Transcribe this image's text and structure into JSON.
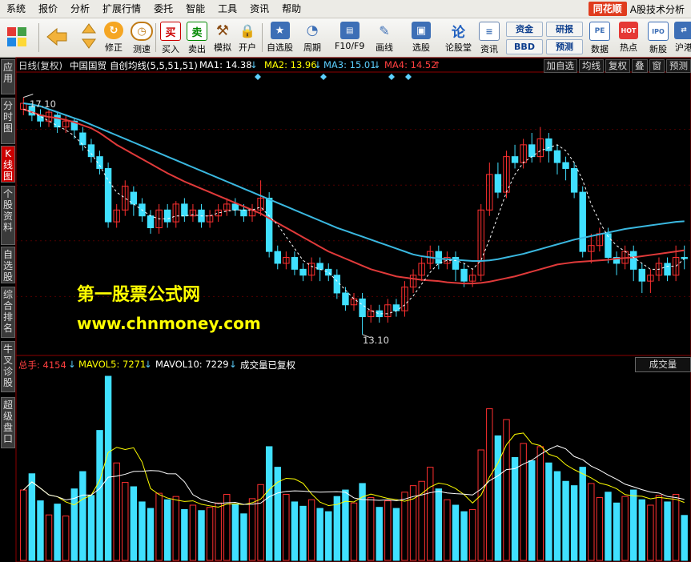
{
  "menubar": {
    "items": [
      "系统",
      "报价",
      "分析",
      "扩展行情",
      "委托",
      "智能",
      "工具",
      "资讯",
      "帮助"
    ],
    "brand_logo": "同花顺",
    "brand_text": "A股技术分析"
  },
  "toolbar": {
    "buttons": [
      "修正",
      "测速",
      "买入",
      "卖出",
      "模拟",
      "开户",
      "自选股",
      "周期",
      "F10/F9",
      "画线",
      "选股",
      "论股堂",
      "资讯",
      "数据",
      "热点",
      "新股",
      "沪港"
    ],
    "small_buttons": [
      "资金",
      "BBD",
      "研报",
      "预测"
    ]
  },
  "left_tabs": [
    "应用",
    "分时图",
    "K线图",
    "个股资料",
    "自选股",
    "综合排名",
    "牛叉诊股",
    "超级盘口"
  ],
  "chart_header": {
    "period": "日线(复权)",
    "stock_name": "中国国贸",
    "indicator": "自创均线(5,5,51,51)",
    "ma1_label": "MA1: 14.38",
    "ma2_label": "MA2: 13.96",
    "ma3_label": "MA3: 15.01",
    "ma4_label": "MA4: 14.52",
    "right_buttons": [
      "加自选",
      "均线",
      "复权",
      "叠",
      "窗",
      "预测"
    ]
  },
  "price_annotations": {
    "high": "17.10",
    "low": "13.10"
  },
  "volume_header": {
    "total": "总手: 4154",
    "mavol5": "MAVOL5: 7271",
    "mavol10": "MAVOL10: 7229",
    "note": "成交量已复权",
    "panel_button": "成交量"
  },
  "watermark": {
    "line1": "第一股票公式网",
    "line2": "www.chnmoney.com"
  },
  "colors": {
    "up": "#ff3030",
    "down": "#40e0ff",
    "ma_blue": "#3ab8e0",
    "ma_red": "#e03a3a",
    "ma_white": "#ffffff",
    "ma_yellow": "#ffff00"
  },
  "chart_data": {
    "type": "candlestick",
    "price_range": [
      12.8,
      17.5
    ],
    "candles": [
      [
        16.9,
        17.0,
        16.8,
        17.1
      ],
      [
        16.95,
        16.8,
        16.7,
        17.0
      ],
      [
        16.8,
        16.7,
        16.6,
        16.9
      ],
      [
        16.7,
        16.85,
        16.6,
        16.9
      ],
      [
        16.8,
        16.6,
        16.5,
        16.85
      ],
      [
        16.6,
        16.7,
        16.5,
        16.8
      ],
      [
        16.7,
        16.55,
        16.4,
        16.75
      ],
      [
        16.5,
        16.3,
        16.2,
        16.6
      ],
      [
        16.3,
        16.1,
        16.0,
        16.4
      ],
      [
        16.1,
        15.9,
        15.8,
        16.2
      ],
      [
        15.9,
        15.0,
        14.9,
        16.0
      ],
      [
        15.0,
        15.2,
        14.9,
        15.3
      ],
      [
        15.2,
        15.6,
        15.1,
        15.7
      ],
      [
        15.5,
        15.3,
        15.1,
        15.6
      ],
      [
        15.3,
        15.1,
        15.0,
        15.4
      ],
      [
        15.1,
        14.9,
        14.8,
        15.2
      ],
      [
        14.9,
        15.2,
        14.8,
        15.3
      ],
      [
        15.2,
        15.0,
        14.9,
        15.3
      ],
      [
        15.0,
        15.3,
        14.9,
        15.35
      ],
      [
        15.3,
        15.1,
        15.0,
        15.4
      ],
      [
        15.1,
        15.2,
        15.0,
        15.3
      ],
      [
        15.2,
        15.0,
        14.9,
        15.3
      ],
      [
        15.0,
        15.1,
        14.9,
        15.2
      ],
      [
        15.1,
        15.2,
        15.0,
        15.3
      ],
      [
        15.2,
        15.3,
        15.1,
        15.4
      ],
      [
        15.3,
        15.2,
        15.1,
        15.4
      ],
      [
        15.2,
        15.1,
        15.0,
        15.3
      ],
      [
        15.1,
        15.2,
        15.0,
        15.3
      ],
      [
        15.2,
        15.4,
        15.1,
        15.7
      ],
      [
        15.4,
        14.5,
        14.4,
        15.5
      ],
      [
        14.5,
        14.3,
        14.2,
        14.6
      ],
      [
        14.3,
        14.4,
        14.2,
        14.5
      ],
      [
        14.4,
        14.2,
        14.1,
        14.5
      ],
      [
        14.2,
        14.1,
        14.0,
        14.3
      ],
      [
        14.1,
        14.3,
        14.0,
        14.4
      ],
      [
        14.3,
        14.2,
        14.0,
        14.4
      ],
      [
        14.2,
        14.1,
        14.0,
        14.3
      ],
      [
        14.1,
        13.8,
        13.7,
        14.2
      ],
      [
        13.8,
        13.6,
        13.5,
        13.9
      ],
      [
        13.6,
        13.7,
        13.5,
        13.8
      ],
      [
        13.7,
        13.4,
        13.1,
        13.8
      ],
      [
        13.4,
        13.5,
        13.3,
        13.6
      ],
      [
        13.5,
        13.4,
        13.3,
        13.6
      ],
      [
        13.4,
        13.6,
        13.3,
        13.7
      ],
      [
        13.6,
        13.5,
        13.4,
        13.7
      ],
      [
        13.5,
        13.9,
        13.4,
        14.0
      ],
      [
        13.9,
        14.1,
        13.8,
        14.2
      ],
      [
        14.1,
        14.3,
        14.0,
        14.4
      ],
      [
        14.3,
        14.5,
        14.2,
        14.6
      ],
      [
        14.5,
        14.3,
        14.2,
        14.6
      ],
      [
        14.3,
        14.4,
        14.2,
        14.5
      ],
      [
        14.4,
        14.2,
        14.0,
        14.5
      ],
      [
        14.2,
        14.0,
        13.9,
        14.3
      ],
      [
        14.0,
        14.1,
        13.9,
        14.2
      ],
      [
        14.1,
        15.2,
        14.0,
        15.3
      ],
      [
        15.2,
        15.8,
        15.1,
        16.0
      ],
      [
        15.8,
        15.5,
        15.4,
        16.0
      ],
      [
        15.5,
        16.1,
        15.4,
        16.2
      ],
      [
        16.1,
        16.0,
        15.9,
        16.3
      ],
      [
        16.0,
        16.3,
        15.9,
        16.4
      ],
      [
        16.3,
        16.1,
        16.0,
        16.5
      ],
      [
        16.1,
        16.4,
        16.0,
        16.6
      ],
      [
        16.4,
        16.2,
        16.0,
        16.5
      ],
      [
        16.2,
        16.0,
        15.8,
        16.3
      ],
      [
        16.0,
        15.9,
        15.7,
        16.1
      ],
      [
        15.9,
        15.5,
        15.4,
        16.0
      ],
      [
        15.5,
        14.5,
        14.4,
        15.6
      ],
      [
        14.5,
        14.6,
        14.3,
        14.8
      ],
      [
        14.6,
        14.8,
        14.5,
        14.9
      ],
      [
        14.8,
        14.4,
        14.3,
        14.9
      ],
      [
        14.4,
        14.3,
        14.1,
        14.5
      ],
      [
        14.3,
        14.5,
        14.2,
        14.6
      ],
      [
        14.5,
        14.2,
        14.0,
        14.6
      ],
      [
        14.2,
        14.0,
        13.8,
        14.3
      ],
      [
        14.0,
        14.1,
        13.8,
        14.2
      ],
      [
        14.1,
        14.3,
        14.0,
        14.4
      ],
      [
        14.3,
        14.1,
        14.0,
        14.4
      ],
      [
        14.1,
        14.4,
        14.0,
        14.6
      ],
      [
        14.4,
        14.38,
        14.2,
        14.6
      ]
    ],
    "volumes": [
      6500,
      8000,
      5500,
      4200,
      5200,
      4100,
      6600,
      8200,
      6000,
      12000,
      17000,
      9000,
      7200,
      6800,
      5400,
      4800,
      6200,
      5600,
      5900,
      4700,
      5100,
      4600,
      4900,
      5300,
      6100,
      5200,
      4300,
      5700,
      7000,
      10500,
      8600,
      6100,
      5400,
      5000,
      5600,
      4800,
      4500,
      5900,
      6500,
      5300,
      7100,
      5800,
      4900,
      5500,
      4800,
      6300,
      6900,
      7300,
      8600,
      6600,
      5600,
      5100,
      4500,
      4700,
      10200,
      14000,
      11500,
      13000,
      9500,
      10800,
      9200,
      10500,
      9000,
      8200,
      7300,
      6900,
      8600,
      7100,
      5800,
      6300,
      5300,
      5900,
      6500,
      5600,
      5100,
      6000,
      5400,
      6100,
      4154
    ],
    "ma_white_dashed": [
      16.9,
      16.85,
      16.78,
      16.7,
      16.62,
      16.55,
      16.45,
      16.3,
      16.15,
      15.95,
      15.7,
      15.5,
      15.4,
      15.3,
      15.2,
      15.1,
      15.05,
      15.05,
      15.1,
      15.1,
      15.12,
      15.1,
      15.1,
      15.15,
      15.18,
      15.2,
      15.2,
      15.2,
      15.25,
      15.1,
      14.95,
      14.75,
      14.55,
      14.35,
      14.25,
      14.2,
      14.15,
      14.0,
      13.85,
      13.7,
      13.6,
      13.5,
      13.45,
      13.45,
      13.5,
      13.6,
      13.75,
      13.95,
      14.15,
      14.3,
      14.35,
      14.35,
      14.3,
      14.2,
      14.35,
      14.7,
      15.1,
      15.5,
      15.8,
      16.0,
      16.1,
      16.2,
      16.25,
      16.3,
      16.2,
      16.0,
      15.7,
      15.3,
      15.0,
      14.75,
      14.6,
      14.5,
      14.4,
      14.3,
      14.2,
      14.2,
      14.25,
      14.25,
      14.38
    ],
    "ma_blue": [
      17.0,
      16.98,
      16.95,
      16.9,
      16.85,
      16.8,
      16.75,
      16.7,
      16.64,
      16.58,
      16.52,
      16.46,
      16.4,
      16.34,
      16.28,
      16.22,
      16.16,
      16.1,
      16.04,
      15.98,
      15.92,
      15.86,
      15.8,
      15.74,
      15.68,
      15.62,
      15.56,
      15.5,
      15.44,
      15.38,
      15.32,
      15.26,
      15.2,
      15.14,
      15.08,
      15.02,
      14.96,
      14.9,
      14.85,
      14.8,
      14.75,
      14.7,
      14.65,
      14.6,
      14.55,
      14.5,
      14.45,
      14.42,
      14.4,
      14.38,
      14.37,
      14.36,
      14.35,
      14.34,
      14.34,
      14.35,
      14.37,
      14.4,
      14.43,
      14.46,
      14.5,
      14.54,
      14.58,
      14.62,
      14.66,
      14.7,
      14.73,
      14.76,
      14.79,
      14.82,
      14.85,
      14.88,
      14.9,
      14.92,
      14.94,
      14.96,
      14.98,
      15.0,
      15.01
    ],
    "ma_red": [
      16.9,
      16.85,
      16.8,
      16.77,
      16.75,
      16.72,
      16.68,
      16.63,
      16.58,
      16.5,
      16.4,
      16.3,
      16.22,
      16.14,
      16.06,
      15.98,
      15.9,
      15.82,
      15.75,
      15.68,
      15.62,
      15.56,
      15.5,
      15.44,
      15.38,
      15.32,
      15.26,
      15.2,
      15.14,
      15.06,
      14.98,
      14.9,
      14.82,
      14.74,
      14.66,
      14.58,
      14.5,
      14.44,
      14.38,
      14.32,
      14.26,
      14.2,
      14.16,
      14.12,
      14.08,
      14.06,
      14.04,
      14.02,
      14.01,
      14.0,
      13.98,
      13.97,
      13.96,
      13.96,
      13.97,
      13.99,
      14.02,
      14.05,
      14.08,
      14.12,
      14.16,
      14.2,
      14.24,
      14.28,
      14.3,
      14.32,
      14.33,
      14.34,
      14.35,
      14.36,
      14.38,
      14.39,
      14.4,
      14.42,
      14.44,
      14.46,
      14.48,
      14.5,
      14.52
    ]
  }
}
